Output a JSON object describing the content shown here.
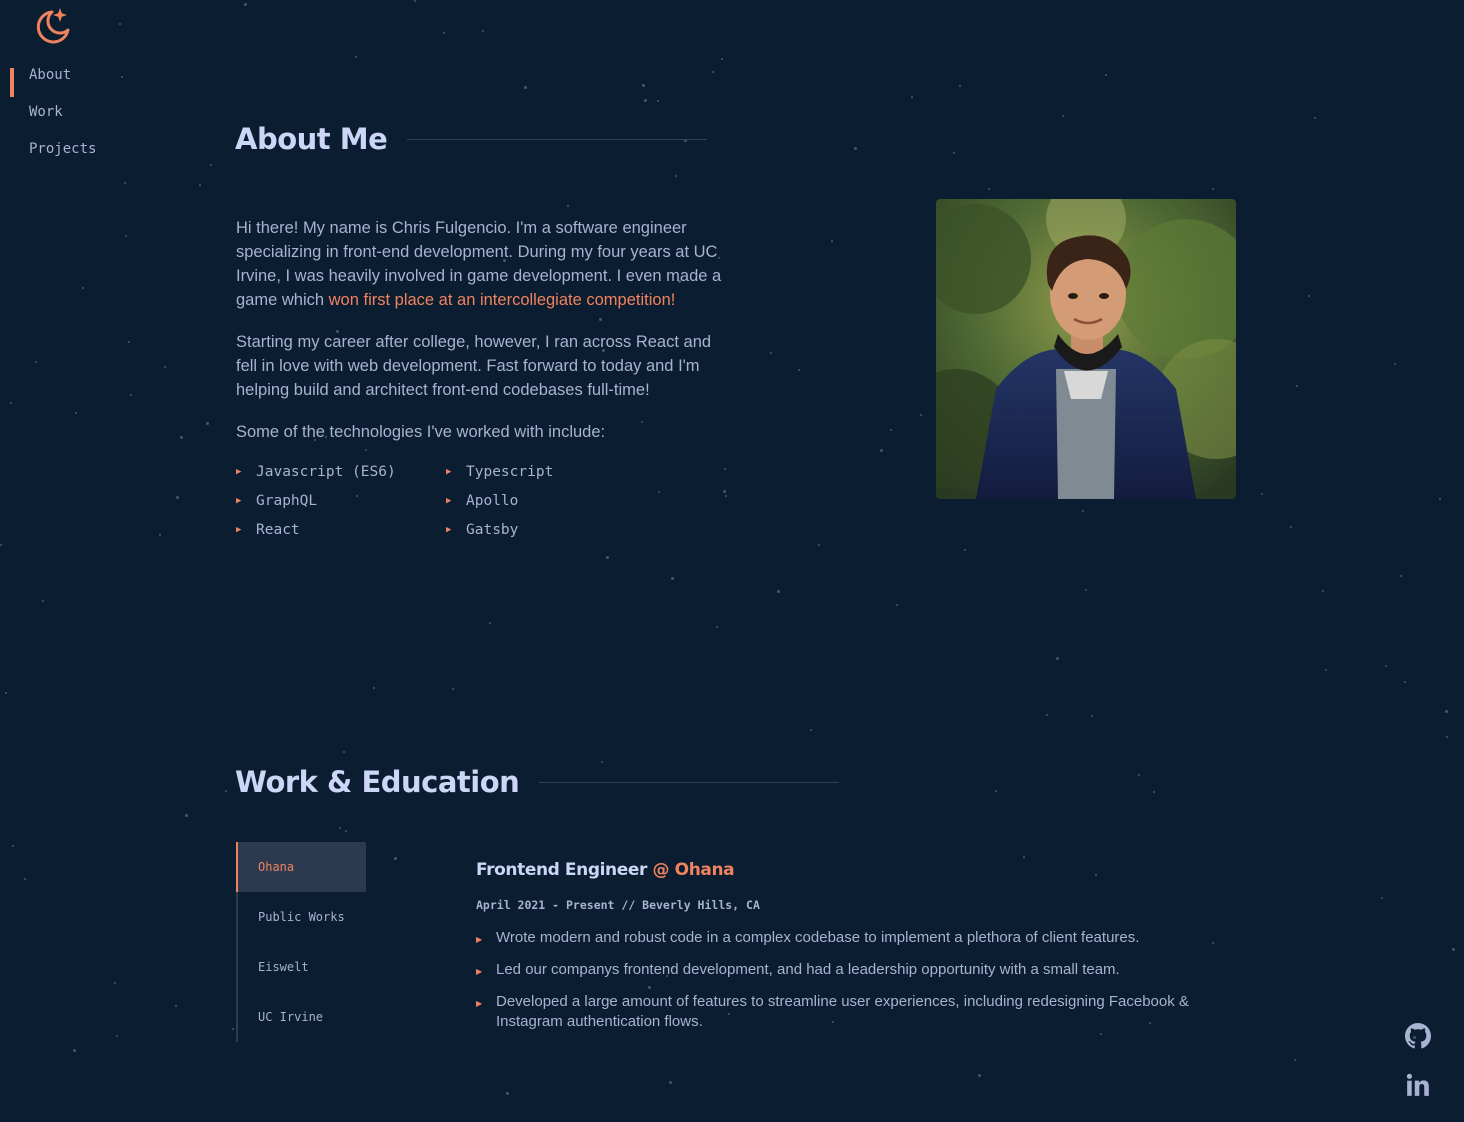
{
  "nav": {
    "logo_icon": "moon-sparkle-icon",
    "items": [
      {
        "label": "About"
      },
      {
        "label": "Work"
      },
      {
        "label": "Projects"
      }
    ]
  },
  "about": {
    "heading": "About Me",
    "p1_start": "Hi there! My name is Chris Fulgencio. I'm a software engineer specializing in front-end development. During my four years at UC Irvine, I was heavily involved in game development. I even made a game which ",
    "p1_link": "won first place at an intercollegiate competition!",
    "p2": "Starting my career after college, however, I ran across React and fell in love with web development. Fast forward to today and I'm helping build and architect front-end codebases full-time!",
    "p3": "Some of the technologies I've worked with include:",
    "technologies": [
      "Javascript (ES6)",
      "Typescript",
      "GraphQL",
      "Apollo",
      "React",
      "Gatsby"
    ]
  },
  "work": {
    "heading": "Work & Education",
    "tabs": [
      "Ohana",
      "Public Works",
      "Eiswelt",
      "UC Irvine"
    ],
    "job": {
      "title": "Frontend Engineer",
      "company": "@ Ohana",
      "range": "April 2021 - Present // Beverly Hills, CA",
      "bullets": [
        "Wrote modern and robust code in a complex codebase to implement a plethora of client features.",
        "Led our companys frontend development, and had a leadership opportunity with a small team.",
        "Developed a large amount of features to streamline user experiences, including redesigning Facebook & Instagram authentication flows."
      ]
    }
  },
  "social": [
    "github-icon",
    "linkedin-icon"
  ],
  "colors": {
    "background": "#0b1d30",
    "accent": "#f0835f",
    "heading": "#ccd6f6",
    "text": "#a8b2d1"
  }
}
